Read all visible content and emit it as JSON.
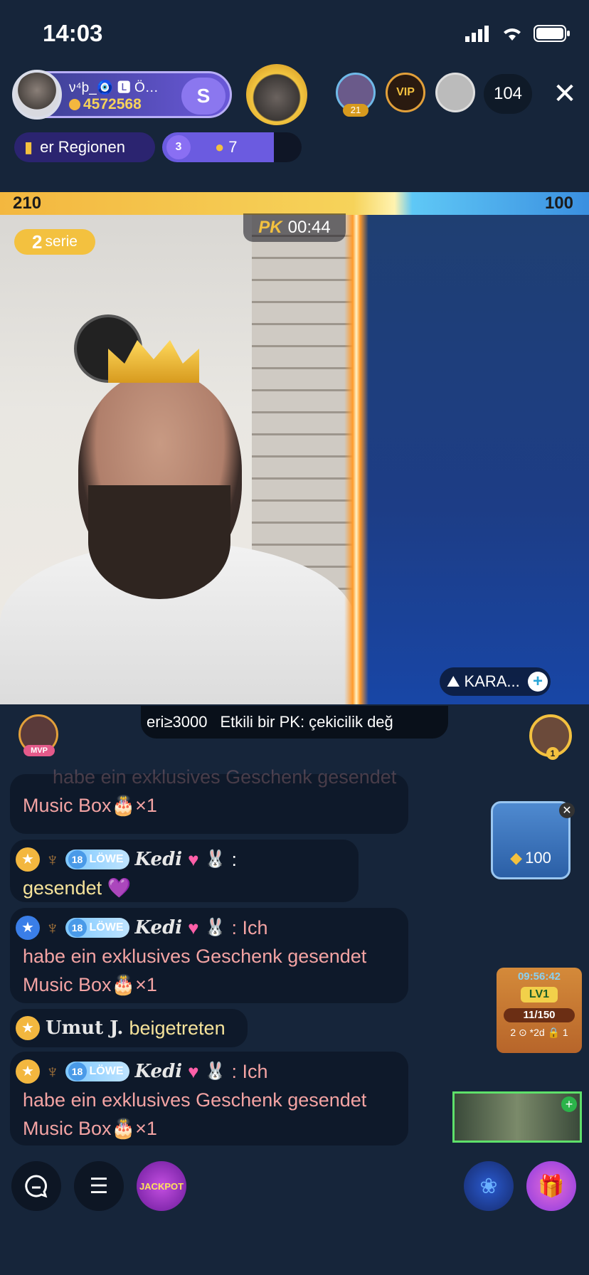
{
  "status_bar": {
    "time": "14:03"
  },
  "host": {
    "name": "ν⁴þ_🧿 🅻 Ö…",
    "coins": "4572568",
    "follow_icon": "S"
  },
  "viewers": {
    "level_badge": "21",
    "vip_label": "VIP",
    "count": "104"
  },
  "region": {
    "label": "er Regionen"
  },
  "stars": {
    "badge": "3",
    "count": "7"
  },
  "pk": {
    "left_score": "210",
    "right_score": "100",
    "logo": "PK",
    "timer": "00:44",
    "serie_number": "2",
    "serie_label": "serie",
    "opponent_name": "KARA..."
  },
  "ticker": {
    "items": [
      "eri≥3000",
      "Etkili bir PK: çekicilik değ"
    ]
  },
  "chat": {
    "faded_line": "habe ein exklusives Geschenk gesendet",
    "msg0_line": "Music Box🎂×1",
    "msg1": {
      "level": "18",
      "badge": "LÖWE",
      "user": "Kedi",
      "sep": ":",
      "text": "gesendet 💜"
    },
    "msg2": {
      "level": "18",
      "badge": "LÖWE",
      "user": "Kedi",
      "text1": ": Ich",
      "text2": "habe ein exklusives Geschenk gesendet",
      "text3": "Music Box🎂×1"
    },
    "msg3": {
      "user": "Umut J.",
      "text": "beigetreten"
    },
    "msg4": {
      "level": "18",
      "badge": "LÖWE",
      "user": "Kedi",
      "text1": ": Ich",
      "text2": "habe ein exklusives Geschenk gesendet",
      "text3": "Music Box🎂×1"
    }
  },
  "side_cards": {
    "diamond_value": "100",
    "lv_timer": "09:56:42",
    "lv_badge": "LV1",
    "lv_progress": "11/150",
    "lv_footer": "2 ⊙ *2d 🔒 1"
  },
  "bottom_bar": {
    "jackpot_label": "JACKPOT"
  }
}
